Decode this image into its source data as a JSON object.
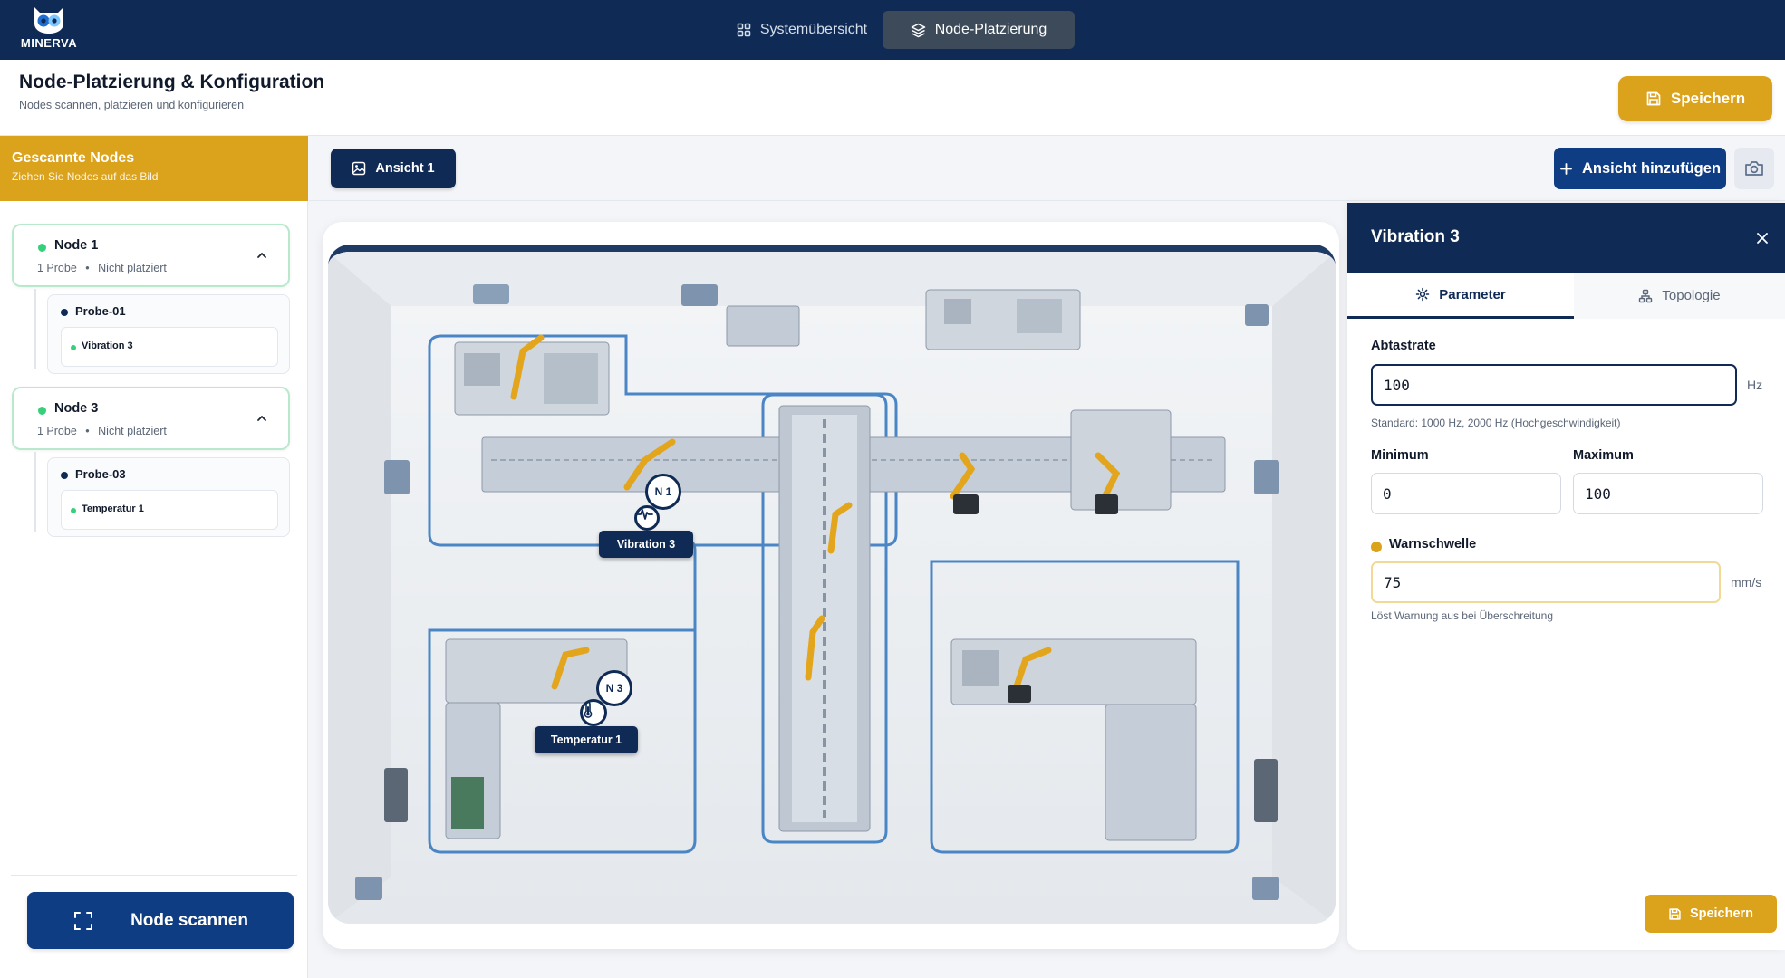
{
  "app": {
    "brand": "MINERVA"
  },
  "nav": {
    "tabs": [
      {
        "label": "Systemübersicht",
        "active": false
      },
      {
        "label": "Node-Platzierung",
        "active": true
      }
    ]
  },
  "header": {
    "title": "Node-Platzierung & Konfiguration",
    "subtitle": "Nodes scannen, platzieren und konfigurieren",
    "save_label": "Speichern"
  },
  "sidebar": {
    "title": "Gescannte Nodes",
    "subtitle": "Ziehen Sie Nodes auf das Bild",
    "nodes": [
      {
        "name": "Node 1",
        "probe_count": "1 Probe",
        "status": "Nicht platziert",
        "probe": "Probe-01",
        "sensor": "Vibration 3"
      },
      {
        "name": "Node 3",
        "probe_count": "1 Probe",
        "status": "Nicht platziert",
        "probe": "Probe-03",
        "sensor": "Temperatur 1"
      }
    ],
    "separator": "•",
    "scan_label": "Node scannen"
  },
  "toolbar": {
    "view_label": "Ansicht 1",
    "add_view_label": "Ansicht hinzufügen"
  },
  "canvas": {
    "markers": [
      {
        "label": "N 1",
        "sensor": "Vibration 3"
      },
      {
        "label": "N 3",
        "sensor": "Temperatur 1"
      }
    ]
  },
  "panel": {
    "title": "Vibration 3",
    "tabs": [
      {
        "label": "Parameter",
        "active": true
      },
      {
        "label": "Topologie",
        "active": false
      }
    ],
    "sample_rate": {
      "label": "Abtastrate",
      "value": "100",
      "unit": "Hz",
      "hint": "Standard: 1000 Hz, 2000 Hz (Hochgeschwindigkeit)"
    },
    "minimum": {
      "label": "Minimum",
      "value": "0"
    },
    "maximum": {
      "label": "Maximum",
      "value": "100"
    },
    "warning": {
      "label": "Warnschwelle",
      "value": "75",
      "unit": "mm/s",
      "hint": "Löst Warnung aus bei Überschreitung"
    },
    "save_label": "Speichern"
  },
  "colors": {
    "navy": "#0f2b55",
    "accent": "#dba21c",
    "status_green": "#35d07a"
  }
}
